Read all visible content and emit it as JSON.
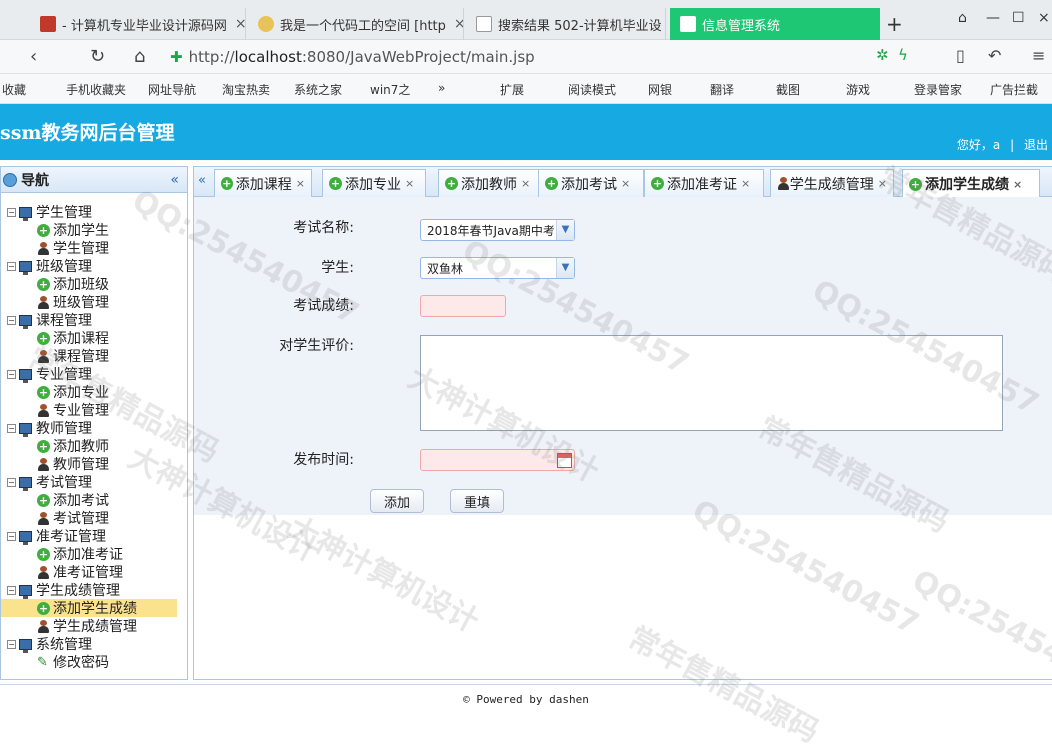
{
  "browser": {
    "tabs": [
      {
        "label": "- 计算机专业毕业设计源码网"
      },
      {
        "label": "我是一个代码工的空间 [http"
      },
      {
        "label": "搜索结果 502-计算机毕业设"
      },
      {
        "label": "信息管理系统"
      }
    ],
    "new_tab": "+",
    "url_prefix": "http://",
    "url_host": "localhost",
    "url_rest": ":8080/JavaWebProject/main.jsp",
    "bookmarks": [
      "收藏",
      "手机收藏夹",
      "网址导航",
      "淘宝热卖",
      "系统之家",
      "win7之",
      "»",
      "扩展",
      "阅读模式",
      "网银",
      "翻译",
      "截图",
      "游戏",
      "登录管家",
      "广告拦截"
    ]
  },
  "header": {
    "title": "ssm教务网后台管理",
    "greeting": "您好，a",
    "sep": "|",
    "logout": "退出"
  },
  "sidebar": {
    "title": "导航",
    "collapse": "«",
    "groups": [
      {
        "label": "学生管理",
        "children": [
          {
            "label": "添加学生",
            "icon": "add"
          },
          {
            "label": "学生管理",
            "icon": "user"
          }
        ]
      },
      {
        "label": "班级管理",
        "children": [
          {
            "label": "添加班级",
            "icon": "add"
          },
          {
            "label": "班级管理",
            "icon": "user"
          }
        ]
      },
      {
        "label": "课程管理",
        "children": [
          {
            "label": "添加课程",
            "icon": "add"
          },
          {
            "label": "课程管理",
            "icon": "user"
          }
        ]
      },
      {
        "label": "专业管理",
        "children": [
          {
            "label": "添加专业",
            "icon": "add"
          },
          {
            "label": "专业管理",
            "icon": "user"
          }
        ]
      },
      {
        "label": "教师管理",
        "children": [
          {
            "label": "添加教师",
            "icon": "add"
          },
          {
            "label": "教师管理",
            "icon": "user"
          }
        ]
      },
      {
        "label": "考试管理",
        "children": [
          {
            "label": "添加考试",
            "icon": "add"
          },
          {
            "label": "考试管理",
            "icon": "user"
          }
        ]
      },
      {
        "label": "准考证管理",
        "children": [
          {
            "label": "添加准考证",
            "icon": "add"
          },
          {
            "label": "准考证管理",
            "icon": "user"
          }
        ]
      },
      {
        "label": "学生成绩管理",
        "children": [
          {
            "label": "添加学生成绩",
            "icon": "add",
            "selected": true
          },
          {
            "label": "学生成绩管理",
            "icon": "user"
          }
        ]
      },
      {
        "label": "系统管理",
        "children": [
          {
            "label": "修改密码",
            "icon": "pen"
          }
        ]
      }
    ]
  },
  "page_tabs": {
    "scroll_left": "«",
    "items": [
      {
        "label": "添加课程",
        "icon": "add"
      },
      {
        "label": "添加专业",
        "icon": "add"
      },
      {
        "label": "添加教师",
        "icon": "add"
      },
      {
        "label": "添加考试",
        "icon": "add"
      },
      {
        "label": "添加准考证",
        "icon": "add"
      },
      {
        "label": "学生成绩管理",
        "icon": "user"
      },
      {
        "label": "添加学生成绩",
        "icon": "add",
        "active": true
      }
    ]
  },
  "form": {
    "exam_label": "考试名称:",
    "exam_value": "2018年春节Java期中考",
    "student_label": "学生:",
    "student_value": "双鱼林",
    "score_label": "考试成绩:",
    "score_value": "",
    "comment_label": "对学生评价:",
    "comment_value": "",
    "time_label": "发布时间:",
    "time_value": "",
    "submit": "添加",
    "reset": "重填"
  },
  "footer": {
    "text": "© Powered by dashen"
  },
  "watermarks": [
    "常年售精品源码",
    "QQ:254540457",
    "大神计算机设计",
    "QQ:254540457",
    "常年售精品源码",
    "QQ:254540457",
    "大神计算机设计",
    "常年售精品源码",
    "QQ:254540457",
    "大神计算机设计",
    "QQ:254540457",
    "常年售精品源码"
  ],
  "colors": {
    "header": "#17a9e2",
    "active_browser_tab": "#1ec773",
    "selected_node": "#fbe38d"
  }
}
